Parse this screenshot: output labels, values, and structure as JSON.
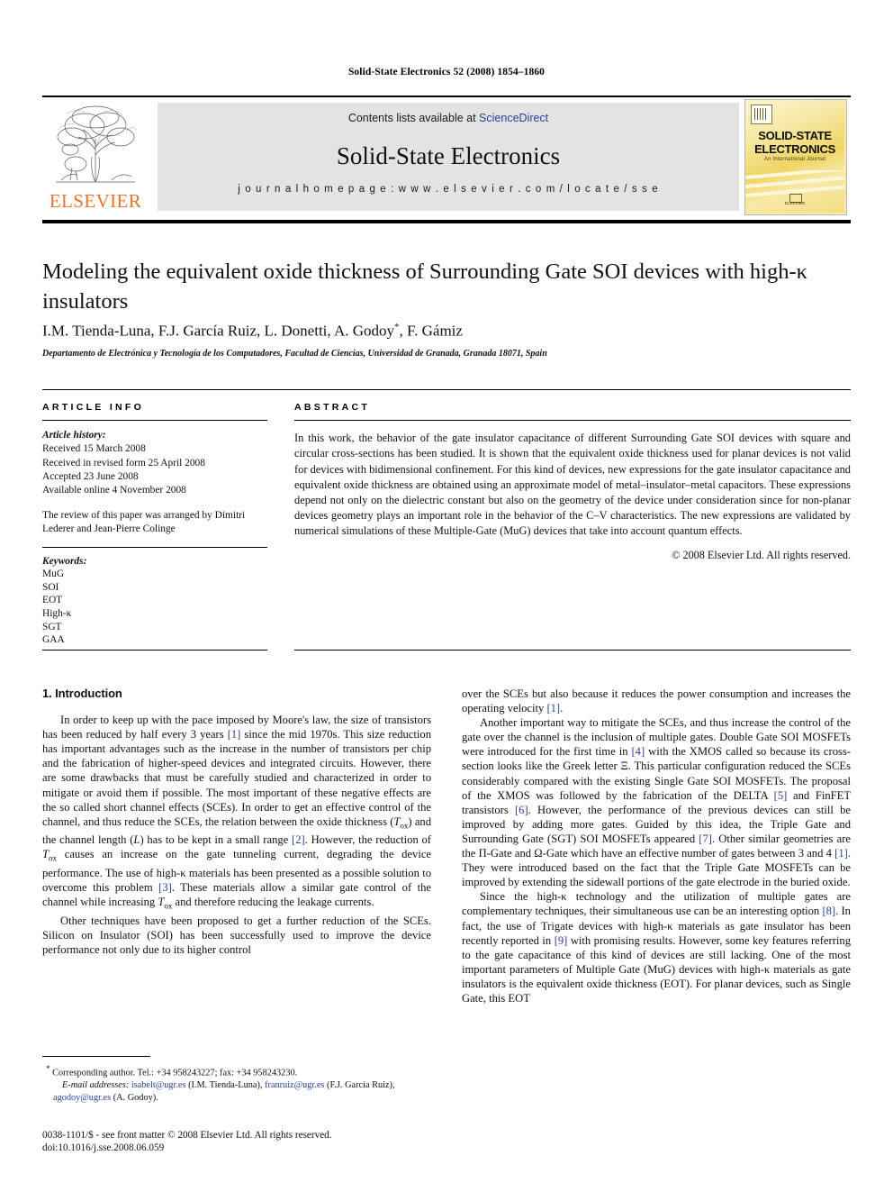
{
  "running_head": "Solid-State Electronics 52 (2008) 1854–1860",
  "masthead": {
    "contents_prefix": "Contents lists available at ",
    "sciencedirect": "ScienceDirect",
    "journal_name": "Solid-State Electronics",
    "homepage": "j o u r n a l   h o m e p a g e :   w w w . e l s e v i e r . c o m / l o c a t e / s s e",
    "publisher_wordmark": "ELSEVIER",
    "cover": {
      "line1": "SOLID-STATE",
      "line2": "ELECTRONICS",
      "subtitle": "An International Journal",
      "footer": "ELSEVIER"
    },
    "link_color": "#2b3f91",
    "band_color": "#e3e3e3",
    "elsevier_orange": "#E8762C"
  },
  "article": {
    "title": "Modeling the equivalent oxide thickness of Surrounding Gate SOI devices with high-κ insulators",
    "authors": "I.M. Tienda-Luna, F.J. García Ruiz, L. Donetti, A. Godoy",
    "authors_tail": ", F. Gámiz",
    "corresponding_marker": "*",
    "affiliation": "Departamento de Electrónica y Tecnología de los Computadores, Facultad de Ciencias, Universidad de Granada, Granada 18071, Spain"
  },
  "article_info": {
    "heading": "ARTICLE INFO",
    "history_label": "Article history:",
    "history": [
      "Received 15 March 2008",
      "Received in revised form 25 April 2008",
      "Accepted 23 June 2008",
      "Available online 4 November 2008"
    ],
    "review_note": "The review of this paper was arranged by Dimitri Lederer and Jean-Pierre Colinge",
    "keywords_label": "Keywords:",
    "keywords": [
      "MuG",
      "SOI",
      "EOT",
      "High-κ",
      "SGT",
      "GAA"
    ]
  },
  "abstract": {
    "heading": "ABSTRACT",
    "text": "In this work, the behavior of the gate insulator capacitance of different Surrounding Gate SOI devices with square and circular cross-sections has been studied. It is shown that the equivalent oxide thickness used for planar devices is not valid for devices with bidimensional confinement. For this kind of devices, new expressions for the gate insulator capacitance and equivalent oxide thickness are obtained using an approximate model of metal–insulator–metal capacitors. These expressions depend not only on the dielectric constant but also on the geometry of the device under consideration since for non-planar devices geometry plays an important role in the behavior of the C–V characteristics. The new expressions are validated by numerical simulations of these Multiple-Gate (MuG) devices that take into account quantum effects.",
    "copyright": "© 2008 Elsevier Ltd. All rights reserved."
  },
  "body": {
    "section_heading": "1. Introduction",
    "left_paragraphs": [
      "In order to keep up with the pace imposed by Moore's law, the size of transistors has been reduced by half every 3 years [1] since the mid 1970s. This size reduction has important advantages such as the increase in the number of transistors per chip and the fabrication of higher-speed devices and integrated circuits. However, there are some drawbacks that must be carefully studied and characterized in order to mitigate or avoid them if possible. The most important of these negative effects are the so called short channel effects (SCEs). In order to get an effective control of the channel, and thus reduce the SCEs, the relation between the oxide thickness (Tox) and the channel length (L) has to be kept in a small range [2]. However, the reduction of Tox causes an increase on the gate tunneling current, degrading the device performance. The use of high-κ materials has been presented as a possible solution to overcome this problem [3]. These materials allow a similar gate control of the channel while increasing Tox and therefore reducing the leakage currents.",
      "Other techniques have been proposed to get a further reduction of the SCEs. Silicon on Insulator (SOI) has been successfully used to improve the device performance not only due to its higher control"
    ],
    "right_paragraphs": [
      "over the SCEs but also because it reduces the power consumption and increases the operating velocity [1].",
      "Another important way to mitigate the SCEs, and thus increase the control of the gate over the channel is the inclusion of multiple gates. Double Gate SOI MOSFETs were introduced for the first time in [4] with the XMOS called so because its cross-section looks like the Greek letter Ξ. This particular configuration reduced the SCEs considerably compared with the existing Single Gate SOI MOSFETs. The proposal of the XMOS was followed by the fabrication of the DELTA [5] and FinFET transistors [6]. However, the performance of the previous devices can still be improved by adding more gates. Guided by this idea, the Triple Gate and Surrounding Gate (SGT) SOI MOSFETs appeared [7]. Other similar geometries are the Π-Gate and Ω-Gate which have an effective number of gates between 3 and 4 [1]. They were introduced based on the fact that the Triple Gate MOSFETs can be improved by extending the sidewall portions of the gate electrode in the buried oxide.",
      "Since the high-κ technology and the utilization of multiple gates are complementary techniques, their simultaneous use can be an interesting option [8]. In fact, the use of Trigate devices with high-κ materials as gate insulator has been recently reported in [9] with promising results. However, some key features referring to the gate capacitance of this kind of devices are still lacking. One of the most important parameters of Multiple Gate (MuG) devices with high-κ materials as gate insulators is the equivalent oxide thickness (EOT). For planar devices, such as Single Gate, this EOT"
    ]
  },
  "footnotes": {
    "corresponding": "Corresponding author. Tel.: +34 958243227; fax: +34 958243230.",
    "email_label": "E-mail addresses:",
    "emails": [
      {
        "address": "isabelt@ugr.es",
        "name": "(I.M. Tienda-Luna)"
      },
      {
        "address": "franruiz@ugr.es",
        "name": "(F.J. García Ruiz)"
      },
      {
        "address": "agodoy@ugr.es",
        "name": "(A. Godoy)."
      }
    ]
  },
  "imprint": {
    "line1": "0038-1101/$ - see front matter © 2008 Elsevier Ltd. All rights reserved.",
    "line2": "doi:10.1016/j.sse.2008.06.059"
  }
}
